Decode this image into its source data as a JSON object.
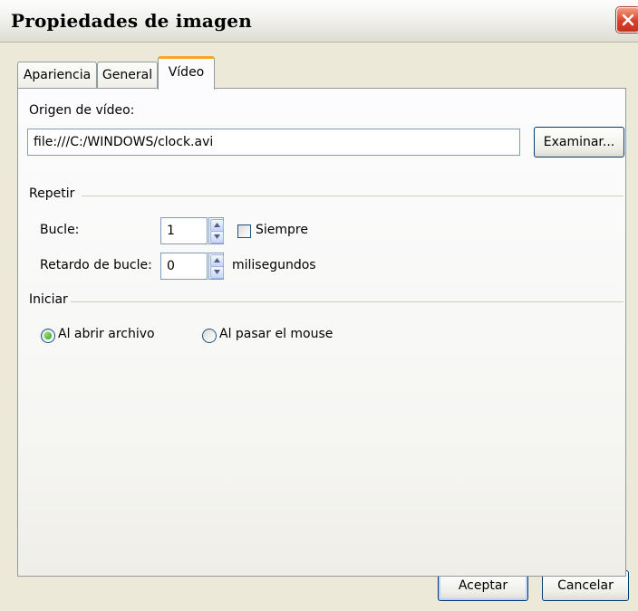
{
  "window": {
    "title": "Propiedades de imagen"
  },
  "tabs": [
    {
      "label": "Apariencia",
      "active": false
    },
    {
      "label": "General",
      "active": false
    },
    {
      "label": "Vídeo",
      "active": true
    }
  ],
  "video": {
    "source_label": "Origen de vídeo:",
    "source_value": "file:///C:/WINDOWS/clock.avi",
    "browse_label": "Examinar..."
  },
  "repeat": {
    "group_label": "Repetir",
    "loop_label": "Bucle:",
    "loop_value": "1",
    "always_label": "Siempre",
    "always_checked": false,
    "delay_label": "Retardo de bucle:",
    "delay_value": "0",
    "delay_unit": "milisegundos"
  },
  "start": {
    "group_label": "Iniciar",
    "options": [
      {
        "label": "Al abrir archivo",
        "selected": true
      },
      {
        "label": "Al pasar el mouse",
        "selected": false
      }
    ]
  },
  "footer": {
    "ok_label": "Aceptar",
    "cancel_label": "Cancelar"
  }
}
